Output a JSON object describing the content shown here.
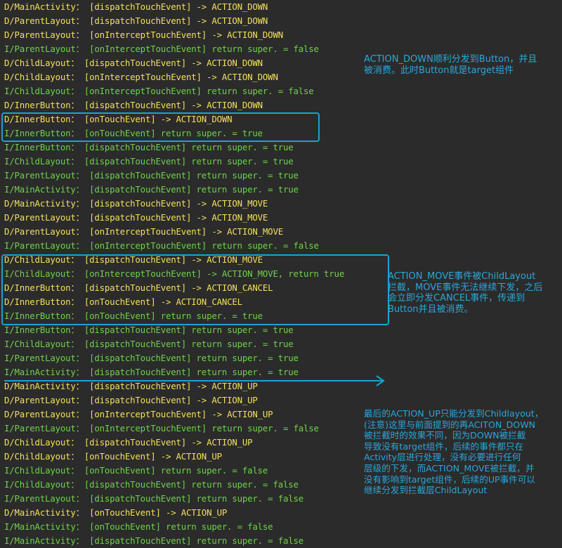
{
  "colors": {
    "debug": "#f2e05a",
    "info": "#6ed24a",
    "annotation": "#2aa7dc",
    "background": "#2b2b2b"
  },
  "log_lines": [
    {
      "level": "D",
      "text": "D/MainActivity： [dispatchTouchEvent] -> ACTION_DOWN"
    },
    {
      "level": "D",
      "text": "D/ParentLayout： [dispatchTouchEvent] -> ACTION_DOWN"
    },
    {
      "level": "D",
      "text": "D/ParentLayout： [onInterceptTouchEvent] -> ACTION_DOWN"
    },
    {
      "level": "I",
      "text": "I/ParentLayout： [onInterceptTouchEvent] return super. = false"
    },
    {
      "level": "D",
      "text": "D/ChildLayout： [dispatchTouchEvent] -> ACTION_DOWN"
    },
    {
      "level": "D",
      "text": "D/ChildLayout： [onInterceptTouchEvent] -> ACTION_DOWN"
    },
    {
      "level": "I",
      "text": "I/ChildLayout： [onInterceptTouchEvent] return super. = false"
    },
    {
      "level": "D",
      "text": "D/InnerButton： [dispatchTouchEvent] -> ACTION_DOWN"
    },
    {
      "level": "D",
      "text": "D/InnerButton： [onTouchEvent] -> ACTION_DOWN"
    },
    {
      "level": "I",
      "text": "I/InnerButton： [onTouchEvent] return super. = true"
    },
    {
      "level": "I",
      "text": "I/InnerButton： [dispatchTouchEvent] return super. = true"
    },
    {
      "level": "I",
      "text": "I/ChildLayout： [dispatchTouchEvent] return super. = true"
    },
    {
      "level": "I",
      "text": "I/ParentLayout： [dispatchTouchEvent] return super. = true"
    },
    {
      "level": "I",
      "text": "I/MainActivity： [dispatchTouchEvent] return super. = true"
    },
    {
      "level": "D",
      "text": "D/MainActivity： [dispatchTouchEvent] -> ACTION_MOVE"
    },
    {
      "level": "D",
      "text": "D/ParentLayout： [dispatchTouchEvent] -> ACTION_MOVE"
    },
    {
      "level": "D",
      "text": "D/ParentLayout： [onInterceptTouchEvent] -> ACTION_MOVE"
    },
    {
      "level": "I",
      "text": "I/ParentLayout： [onInterceptTouchEvent] return super. = false"
    },
    {
      "level": "D",
      "text": "D/ChildLayout： [dispatchTouchEvent] -> ACTION_MOVE"
    },
    {
      "level": "I",
      "text": "I/ChildLayout： [onInterceptTouchEvent] -> ACTION_MOVE, return true"
    },
    {
      "level": "D",
      "text": "D/InnerButton： [dispatchTouchEvent] -> ACTION_CANCEL"
    },
    {
      "level": "D",
      "text": "D/InnerButton： [onTouchEvent] -> ACTION_CANCEL"
    },
    {
      "level": "I",
      "text": "I/InnerButton： [onTouchEvent] return super. = true"
    },
    {
      "level": "I",
      "text": "I/InnerButton： [dispatchTouchEvent] return super. = true"
    },
    {
      "level": "I",
      "text": "I/ChildLayout： [dispatchTouchEvent] return super. = true"
    },
    {
      "level": "I",
      "text": "I/ParentLayout： [dispatchTouchEvent] return super. = true"
    },
    {
      "level": "I",
      "text": "I/MainActivity： [dispatchTouchEvent] return super. = true"
    },
    {
      "level": "D",
      "text": "D/MainActivity： [dispatchTouchEvent] -> ACTION_UP"
    },
    {
      "level": "D",
      "text": "D/ParentLayout： [dispatchTouchEvent] -> ACTION_UP"
    },
    {
      "level": "D",
      "text": "D/ParentLayout： [onInterceptTouchEvent] -> ACTION_UP"
    },
    {
      "level": "I",
      "text": "I/ParentLayout： [onInterceptTouchEvent] return super. = false"
    },
    {
      "level": "D",
      "text": "D/ChildLayout： [dispatchTouchEvent] -> ACTION_UP"
    },
    {
      "level": "D",
      "text": "D/ChildLayout： [onTouchEvent] -> ACTION_UP"
    },
    {
      "level": "I",
      "text": "I/ChildLayout： [onTouchEvent] return super. = false"
    },
    {
      "level": "I",
      "text": "I/ChildLayout： [dispatchTouchEvent] return super. = false"
    },
    {
      "level": "I",
      "text": "I/ParentLayout： [dispatchTouchEvent] return super. = false"
    },
    {
      "level": "D",
      "text": "D/MainActivity： [onTouchEvent] -> ACTION_UP"
    },
    {
      "level": "I",
      "text": "I/MainActivity： [onTouchEvent] return super. = false"
    },
    {
      "level": "I",
      "text": "I/MainActivity： [dispatchTouchEvent] return super. = false"
    }
  ],
  "annotations": {
    "down": "ACTION_DOWN顺利分发到Button，并且\n被消费。此时Button就是target组件",
    "move": "ACTION_MOVE事件被ChildLayout\n拦截，MOVE事件无法继续下发，之后\n会立即分发CANCEL事件，传递到\nButton并且被消费。",
    "up": "最后的ACTION_UP只能分发到Childlayout，\n(注意)这里与前面提到的再ACITON_DOWN\n被拦截时的效果不同，因为DOWN被拦截\n导致没有target组件，后续的事件都只在\nActivity层进行处理，没有必要进行任何\n层级的下发，而ACTION_MOVE被拦截，并\n没有影响到target组件，后续的UP事件可以\n继续分发到拦截层ChildLayout"
  }
}
